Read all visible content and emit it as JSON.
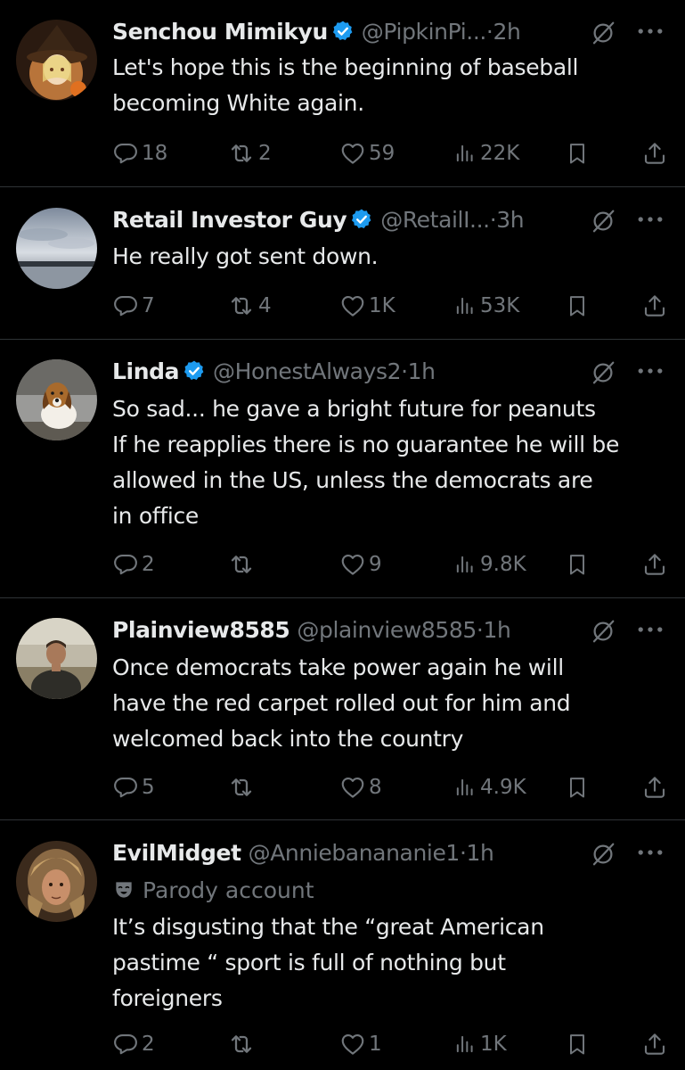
{
  "colors": {
    "background": "#000000",
    "text_primary": "#e7e9ea",
    "text_secondary": "#71767b",
    "divider": "#2f3336",
    "verified_blue": "#1d9bf0"
  },
  "tweets": [
    {
      "name": "Senchou Mimikyu",
      "verified": true,
      "handle": "@PipkinPi...",
      "time": "2h",
      "lines": [
        "Let's hope this is the beginning of baseball",
        "becoming White again."
      ],
      "replies": "18",
      "reposts": "2",
      "likes": "59",
      "views": "22K"
    },
    {
      "name": "Retail Investor Guy",
      "verified": true,
      "handle": "@RetailI...",
      "time": "3h",
      "lines": [
        "He really got sent down."
      ],
      "replies": "7",
      "reposts": "4",
      "likes": "1K",
      "views": "53K"
    },
    {
      "name": "Linda",
      "verified": true,
      "handle": "@HonestAlways2",
      "time": "1h",
      "lines": [
        "So sad... he gave a bright future for peanuts",
        "If he reapplies there is no guarantee he will be",
        "allowed in the US, unless the democrats are",
        "in office"
      ],
      "replies": "2",
      "reposts": "",
      "likes": "9",
      "views": "9.8K"
    },
    {
      "name": "Plainview8585",
      "verified": false,
      "handle": "@plainview8585",
      "time": "1h",
      "lines": [
        "Once democrats take power again he will",
        "have the red carpet rolled out for him and",
        "welcomed back into the country"
      ],
      "replies": "5",
      "reposts": "",
      "likes": "8",
      "views": "4.9K"
    },
    {
      "name": "EvilMidget",
      "verified": false,
      "handle": "@Anniebanananie1",
      "time": "1h",
      "parody_label": "Parody account",
      "lines": [
        "It’s disgusting that the “great American",
        "pastime “ sport is full of nothing but",
        "foreigners"
      ],
      "replies": "2",
      "reposts": "",
      "likes": "1",
      "views": "1K"
    }
  ]
}
